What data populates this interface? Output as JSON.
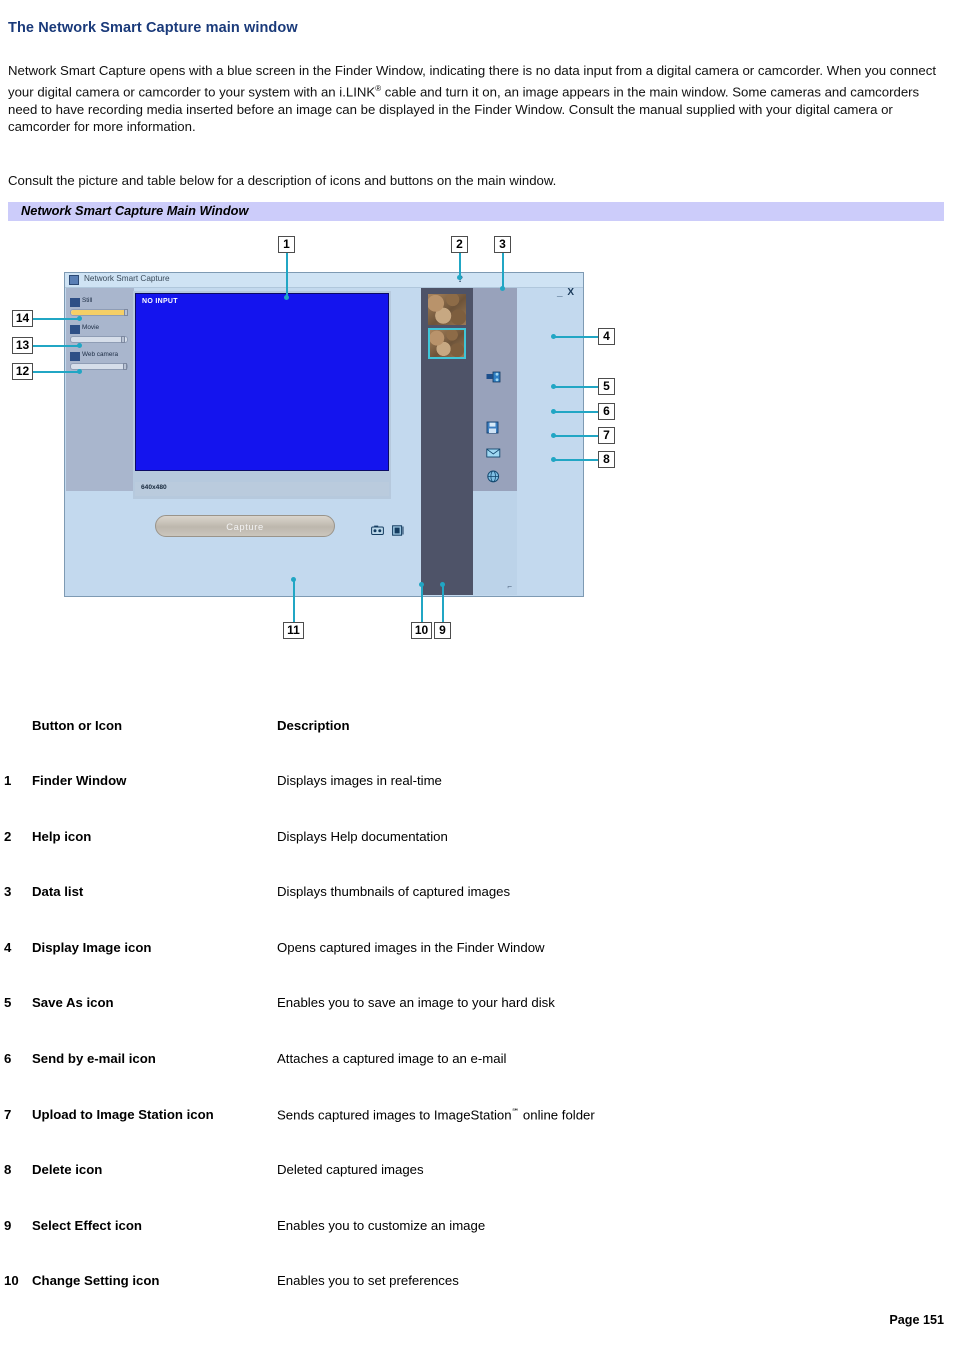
{
  "document": {
    "heading": "The Network Smart Capture main window",
    "paragraph_1_part1": "Network Smart Capture opens with a blue screen in the Finder Window, indicating there is no data input from a digital camera or camcorder. When you connect your digital camera or camcorder to your system with an i.LINK",
    "paragraph_1_reg": "®",
    "paragraph_1_part2": " cable and turn it on, an image appears in the main window. Some cameras and camcorders need to have recording media inserted before an image can be displayed in the Finder Window. Consult the manual supplied with your digital camera or camcorder for more information.",
    "paragraph_2": "Consult the picture and table below for a description of icons and buttons on the main window.",
    "caption_bar": "Network Smart Capture Main Window",
    "page_number": "Page 151"
  },
  "figure": {
    "app_window": {
      "title": "Network Smart Capture",
      "titlebar_icon": "app-icon",
      "help_glyph": "?",
      "window_controls": "_ X",
      "finder_status": "NO INPUT",
      "resolution": "640x480",
      "capture_button": "Capture",
      "resize_grip": "⌐"
    },
    "modes": [
      {
        "label": "Still",
        "icon": "still-camera-icon",
        "fill_percent": 100,
        "knob_percent": 100
      },
      {
        "label": "Movie",
        "icon": "movie-camera-icon",
        "fill_percent": 0,
        "knob_percent": 92
      },
      {
        "label": "Web camera",
        "icon": "web-camera-icon",
        "fill_percent": 0,
        "knob_percent": 96
      }
    ],
    "right_toolbar_icons": [
      {
        "name": "display-image-icon",
        "callout": "4"
      },
      {
        "name": "save-as-icon",
        "callout": "5"
      },
      {
        "name": "send-by-email-icon",
        "callout": "6"
      },
      {
        "name": "upload-to-image-station-icon",
        "callout": "7"
      },
      {
        "name": "delete-icon",
        "callout": "8"
      }
    ],
    "bottom_icons": [
      {
        "name": "change-setting-icon",
        "callout": "10"
      },
      {
        "name": "select-effect-icon",
        "callout": "9"
      }
    ],
    "callouts": [
      {
        "n": "1",
        "target": "finder-window"
      },
      {
        "n": "2",
        "target": "help-icon"
      },
      {
        "n": "3",
        "target": "data-list"
      },
      {
        "n": "4",
        "target": "display-image-icon"
      },
      {
        "n": "5",
        "target": "save-as-icon"
      },
      {
        "n": "6",
        "target": "send-by-email-icon"
      },
      {
        "n": "7",
        "target": "upload-to-image-station-icon"
      },
      {
        "n": "8",
        "target": "delete-icon"
      },
      {
        "n": "9",
        "target": "select-effect-icon"
      },
      {
        "n": "10",
        "target": "change-setting-icon"
      },
      {
        "n": "11",
        "target": "capture-button"
      },
      {
        "n": "12",
        "target": "web-camera-slider"
      },
      {
        "n": "13",
        "target": "movie-slider"
      },
      {
        "n": "14",
        "target": "still-slider"
      }
    ]
  },
  "table": {
    "header": {
      "col1": "Button or Icon",
      "col2": "Description"
    },
    "rows": [
      {
        "num": "1",
        "name": "Finder Window",
        "desc": "Displays images in real-time"
      },
      {
        "num": "2",
        "name": "Help icon",
        "desc": "Displays Help documentation"
      },
      {
        "num": "3",
        "name": "Data list",
        "desc": "Displays thumbnails of captured images"
      },
      {
        "num": "4",
        "name": "Display Image icon",
        "desc": "Opens captured images in the Finder Window"
      },
      {
        "num": "5",
        "name": "Save As icon",
        "desc": "Enables you to save an image to your hard disk"
      },
      {
        "num": "6",
        "name": "Send by e-mail icon",
        "desc": "Attaches a captured image to an e-mail"
      },
      {
        "num": "7",
        "name": "Upload to Image Station icon",
        "desc_pre": "Sends captured images to ImageStation",
        "desc_sm": "℠",
        "desc_post": " online folder"
      },
      {
        "num": "8",
        "name": "Delete icon",
        "desc": "Deleted captured images"
      },
      {
        "num": "9",
        "name": "Select Effect icon",
        "desc": "Enables you to customize an image"
      },
      {
        "num": "10",
        "name": "Change Setting icon",
        "desc": "Enables you to set preferences"
      }
    ]
  },
  "colors": {
    "heading": "#1a3a7a",
    "caption_bar": "#ccccfa",
    "finder_blue": "#1414ee",
    "leader_teal": "#21a6c4",
    "datalist_bg": "#4e5368"
  }
}
